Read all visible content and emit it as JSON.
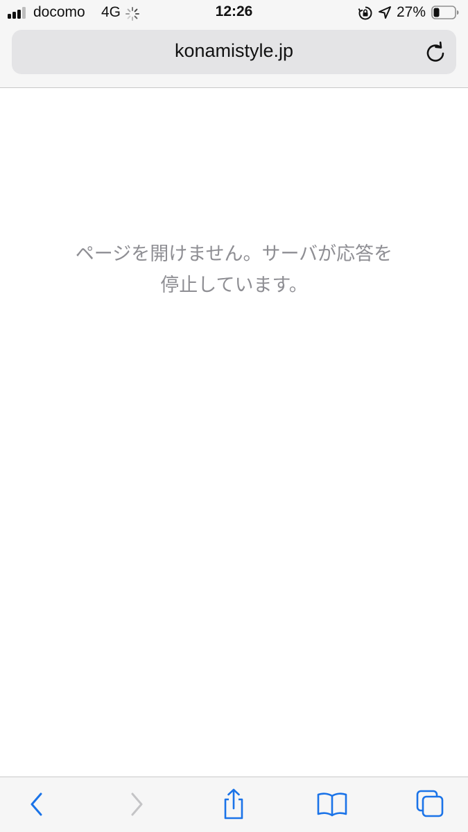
{
  "status_bar": {
    "carrier": "docomo",
    "network": "4G",
    "time": "12:26",
    "battery_percent": "27%",
    "battery_level": 0.27,
    "signal_bars_active": 3,
    "icons": [
      "signal-icon",
      "activity-spinner-icon",
      "orientation-lock-icon",
      "location-arrow-icon",
      "battery-icon"
    ]
  },
  "address_bar": {
    "url": "konamistyle.jp",
    "reload_icon": "reload-icon"
  },
  "content": {
    "error_line_1": "ページを開けません。サーバが応答を",
    "error_line_2": "停止しています。"
  },
  "toolbar": {
    "icons": [
      "back-icon",
      "forward-icon",
      "share-icon",
      "bookmarks-icon",
      "tabs-icon"
    ],
    "accent_color": "#1a73e8",
    "disabled_color": "#c4c4c6"
  }
}
